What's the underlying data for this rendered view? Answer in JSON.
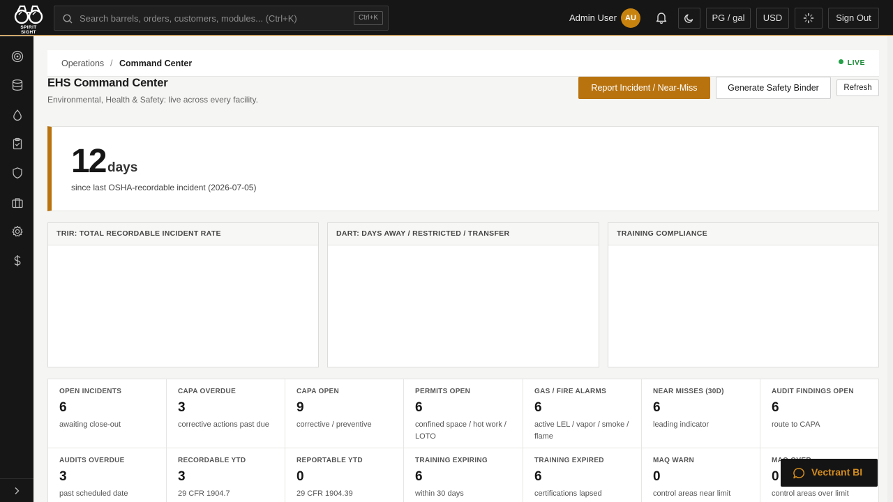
{
  "topbar": {
    "logo_text": "SPIRIT SIGHT",
    "search_placeholder": "Search barrels, orders, customers, modules... (Ctrl+K)",
    "search_shortcut": "Ctrl+K",
    "user_name": "Admin User",
    "user_initials": "AU",
    "unit_toggle": "PG / gal",
    "currency": "USD",
    "sign_out": "Sign Out"
  },
  "sidebar": {
    "items": [
      "target-icon",
      "database-icon",
      "droplet-icon",
      "clipboard-icon",
      "shield-icon",
      "briefcase-icon",
      "gear-icon",
      "dollar-icon"
    ]
  },
  "breadcrumb": {
    "root": "Operations",
    "separator": "/",
    "current": "Command Center",
    "live": "LIVE"
  },
  "header": {
    "title": "EHS Command Center",
    "subtitle": "Environmental, Health & Safety: live across every facility.",
    "report_button": "Report Incident / Near-Miss",
    "binder_button": "Generate Safety Binder",
    "refresh_button": "Refresh"
  },
  "hero": {
    "value": "12",
    "unit": "days",
    "caption": "since last OSHA-recordable incident (2026-07-05)"
  },
  "panels": [
    {
      "title": "TRIR: TOTAL RECORDABLE INCIDENT RATE"
    },
    {
      "title": "DART: DAYS AWAY / RESTRICTED / TRANSFER"
    },
    {
      "title": "TRAINING COMPLIANCE"
    }
  ],
  "kpis": [
    {
      "label": "OPEN INCIDENTS",
      "value": "6",
      "sub": "awaiting close-out"
    },
    {
      "label": "CAPA OVERDUE",
      "value": "3",
      "sub": "corrective actions past due"
    },
    {
      "label": "CAPA OPEN",
      "value": "9",
      "sub": "corrective / preventive"
    },
    {
      "label": "PERMITS OPEN",
      "value": "6",
      "sub": "confined space / hot work / LOTO"
    },
    {
      "label": "GAS / FIRE ALARMS",
      "value": "6",
      "sub": "active LEL / vapor / smoke / flame"
    },
    {
      "label": "NEAR MISSES (30D)",
      "value": "6",
      "sub": "leading indicator"
    },
    {
      "label": "AUDIT FINDINGS OPEN",
      "value": "6",
      "sub": "route to CAPA"
    },
    {
      "label": "AUDITS OVERDUE",
      "value": "3",
      "sub": "past scheduled date"
    },
    {
      "label": "RECORDABLE YTD",
      "value": "3",
      "sub": "29 CFR 1904.7"
    },
    {
      "label": "REPORTABLE YTD",
      "value": "0",
      "sub": "29 CFR 1904.39"
    },
    {
      "label": "TRAINING EXPIRING",
      "value": "6",
      "sub": "within 30 days"
    },
    {
      "label": "TRAINING EXPIRED",
      "value": "6",
      "sub": "certifications lapsed"
    },
    {
      "label": "MAQ WARN",
      "value": "0",
      "sub": "control areas near limit"
    },
    {
      "label": "MAQ OVER",
      "value": "0",
      "sub": "control areas over limit"
    }
  ],
  "assistant": {
    "label": "Vectrant BI"
  }
}
